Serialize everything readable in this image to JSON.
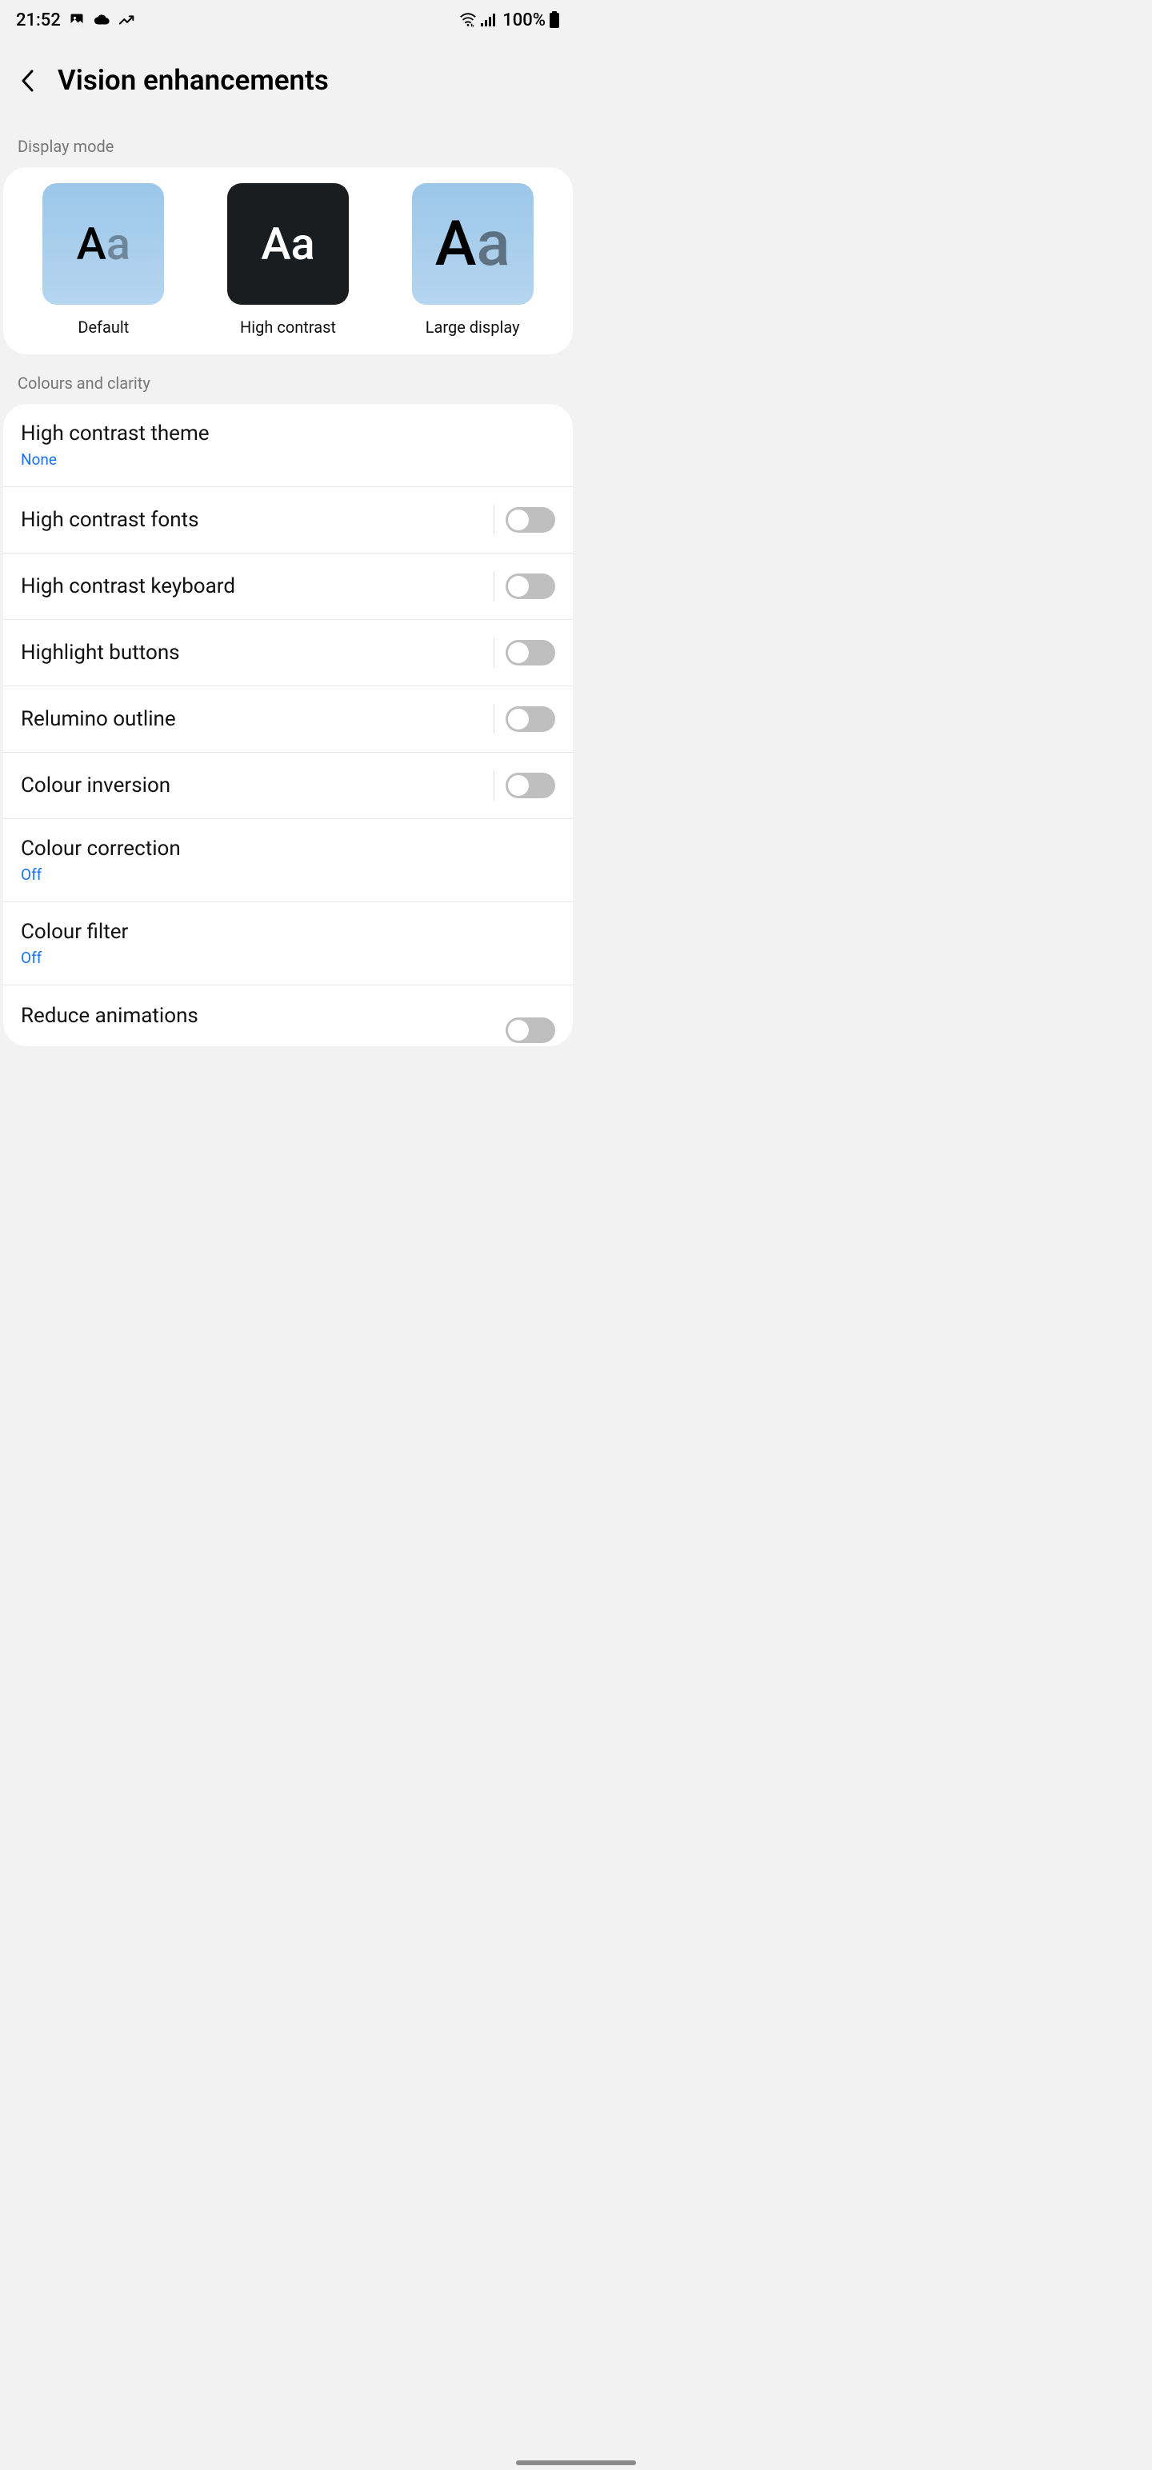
{
  "status": {
    "time": "21:52",
    "battery_text": "100%"
  },
  "header": {
    "title": "Vision enhancements"
  },
  "sections": {
    "display_mode": {
      "header": "Display mode",
      "modes": {
        "default": "Default",
        "high_contrast": "High contrast",
        "large": "Large display"
      }
    },
    "colours": {
      "header": "Colours and clarity",
      "items": {
        "high_contrast_theme": {
          "title": "High contrast theme",
          "sub": "None"
        },
        "high_contrast_fonts": {
          "title": "High contrast fonts"
        },
        "high_contrast_keyboard": {
          "title": "High contrast keyboard"
        },
        "highlight_buttons": {
          "title": "Highlight buttons"
        },
        "relumino_outline": {
          "title": "Relumino outline"
        },
        "colour_inversion": {
          "title": "Colour inversion"
        },
        "colour_correction": {
          "title": "Colour correction",
          "sub": "Off"
        },
        "colour_filter": {
          "title": "Colour filter",
          "sub": "Off"
        },
        "reduce_animations": {
          "title": "Reduce animations"
        }
      }
    }
  }
}
